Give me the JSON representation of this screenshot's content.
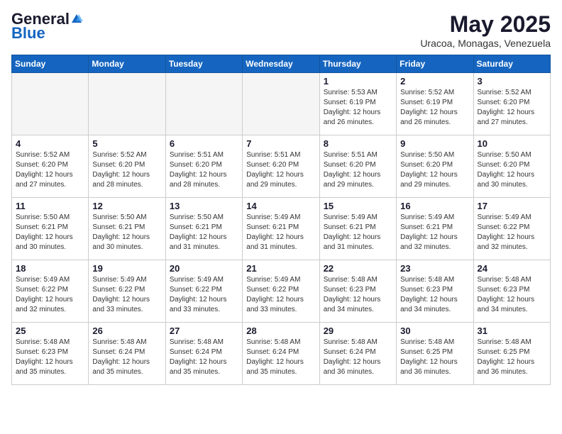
{
  "header": {
    "logo_general": "General",
    "logo_blue": "Blue",
    "month_year": "May 2025",
    "location": "Uracoa, Monagas, Venezuela"
  },
  "weekdays": [
    "Sunday",
    "Monday",
    "Tuesday",
    "Wednesday",
    "Thursday",
    "Friday",
    "Saturday"
  ],
  "weeks": [
    [
      {
        "day": "",
        "info": ""
      },
      {
        "day": "",
        "info": ""
      },
      {
        "day": "",
        "info": ""
      },
      {
        "day": "",
        "info": ""
      },
      {
        "day": "1",
        "info": "Sunrise: 5:53 AM\nSunset: 6:19 PM\nDaylight: 12 hours\nand 26 minutes."
      },
      {
        "day": "2",
        "info": "Sunrise: 5:52 AM\nSunset: 6:19 PM\nDaylight: 12 hours\nand 26 minutes."
      },
      {
        "day": "3",
        "info": "Sunrise: 5:52 AM\nSunset: 6:20 PM\nDaylight: 12 hours\nand 27 minutes."
      }
    ],
    [
      {
        "day": "4",
        "info": "Sunrise: 5:52 AM\nSunset: 6:20 PM\nDaylight: 12 hours\nand 27 minutes."
      },
      {
        "day": "5",
        "info": "Sunrise: 5:52 AM\nSunset: 6:20 PM\nDaylight: 12 hours\nand 28 minutes."
      },
      {
        "day": "6",
        "info": "Sunrise: 5:51 AM\nSunset: 6:20 PM\nDaylight: 12 hours\nand 28 minutes."
      },
      {
        "day": "7",
        "info": "Sunrise: 5:51 AM\nSunset: 6:20 PM\nDaylight: 12 hours\nand 29 minutes."
      },
      {
        "day": "8",
        "info": "Sunrise: 5:51 AM\nSunset: 6:20 PM\nDaylight: 12 hours\nand 29 minutes."
      },
      {
        "day": "9",
        "info": "Sunrise: 5:50 AM\nSunset: 6:20 PM\nDaylight: 12 hours\nand 29 minutes."
      },
      {
        "day": "10",
        "info": "Sunrise: 5:50 AM\nSunset: 6:20 PM\nDaylight: 12 hours\nand 30 minutes."
      }
    ],
    [
      {
        "day": "11",
        "info": "Sunrise: 5:50 AM\nSunset: 6:21 PM\nDaylight: 12 hours\nand 30 minutes."
      },
      {
        "day": "12",
        "info": "Sunrise: 5:50 AM\nSunset: 6:21 PM\nDaylight: 12 hours\nand 30 minutes."
      },
      {
        "day": "13",
        "info": "Sunrise: 5:50 AM\nSunset: 6:21 PM\nDaylight: 12 hours\nand 31 minutes."
      },
      {
        "day": "14",
        "info": "Sunrise: 5:49 AM\nSunset: 6:21 PM\nDaylight: 12 hours\nand 31 minutes."
      },
      {
        "day": "15",
        "info": "Sunrise: 5:49 AM\nSunset: 6:21 PM\nDaylight: 12 hours\nand 31 minutes."
      },
      {
        "day": "16",
        "info": "Sunrise: 5:49 AM\nSunset: 6:21 PM\nDaylight: 12 hours\nand 32 minutes."
      },
      {
        "day": "17",
        "info": "Sunrise: 5:49 AM\nSunset: 6:22 PM\nDaylight: 12 hours\nand 32 minutes."
      }
    ],
    [
      {
        "day": "18",
        "info": "Sunrise: 5:49 AM\nSunset: 6:22 PM\nDaylight: 12 hours\nand 32 minutes."
      },
      {
        "day": "19",
        "info": "Sunrise: 5:49 AM\nSunset: 6:22 PM\nDaylight: 12 hours\nand 33 minutes."
      },
      {
        "day": "20",
        "info": "Sunrise: 5:49 AM\nSunset: 6:22 PM\nDaylight: 12 hours\nand 33 minutes."
      },
      {
        "day": "21",
        "info": "Sunrise: 5:49 AM\nSunset: 6:22 PM\nDaylight: 12 hours\nand 33 minutes."
      },
      {
        "day": "22",
        "info": "Sunrise: 5:48 AM\nSunset: 6:23 PM\nDaylight: 12 hours\nand 34 minutes."
      },
      {
        "day": "23",
        "info": "Sunrise: 5:48 AM\nSunset: 6:23 PM\nDaylight: 12 hours\nand 34 minutes."
      },
      {
        "day": "24",
        "info": "Sunrise: 5:48 AM\nSunset: 6:23 PM\nDaylight: 12 hours\nand 34 minutes."
      }
    ],
    [
      {
        "day": "25",
        "info": "Sunrise: 5:48 AM\nSunset: 6:23 PM\nDaylight: 12 hours\nand 35 minutes."
      },
      {
        "day": "26",
        "info": "Sunrise: 5:48 AM\nSunset: 6:24 PM\nDaylight: 12 hours\nand 35 minutes."
      },
      {
        "day": "27",
        "info": "Sunrise: 5:48 AM\nSunset: 6:24 PM\nDaylight: 12 hours\nand 35 minutes."
      },
      {
        "day": "28",
        "info": "Sunrise: 5:48 AM\nSunset: 6:24 PM\nDaylight: 12 hours\nand 35 minutes."
      },
      {
        "day": "29",
        "info": "Sunrise: 5:48 AM\nSunset: 6:24 PM\nDaylight: 12 hours\nand 36 minutes."
      },
      {
        "day": "30",
        "info": "Sunrise: 5:48 AM\nSunset: 6:25 PM\nDaylight: 12 hours\nand 36 minutes."
      },
      {
        "day": "31",
        "info": "Sunrise: 5:48 AM\nSunset: 6:25 PM\nDaylight: 12 hours\nand 36 minutes."
      }
    ]
  ]
}
